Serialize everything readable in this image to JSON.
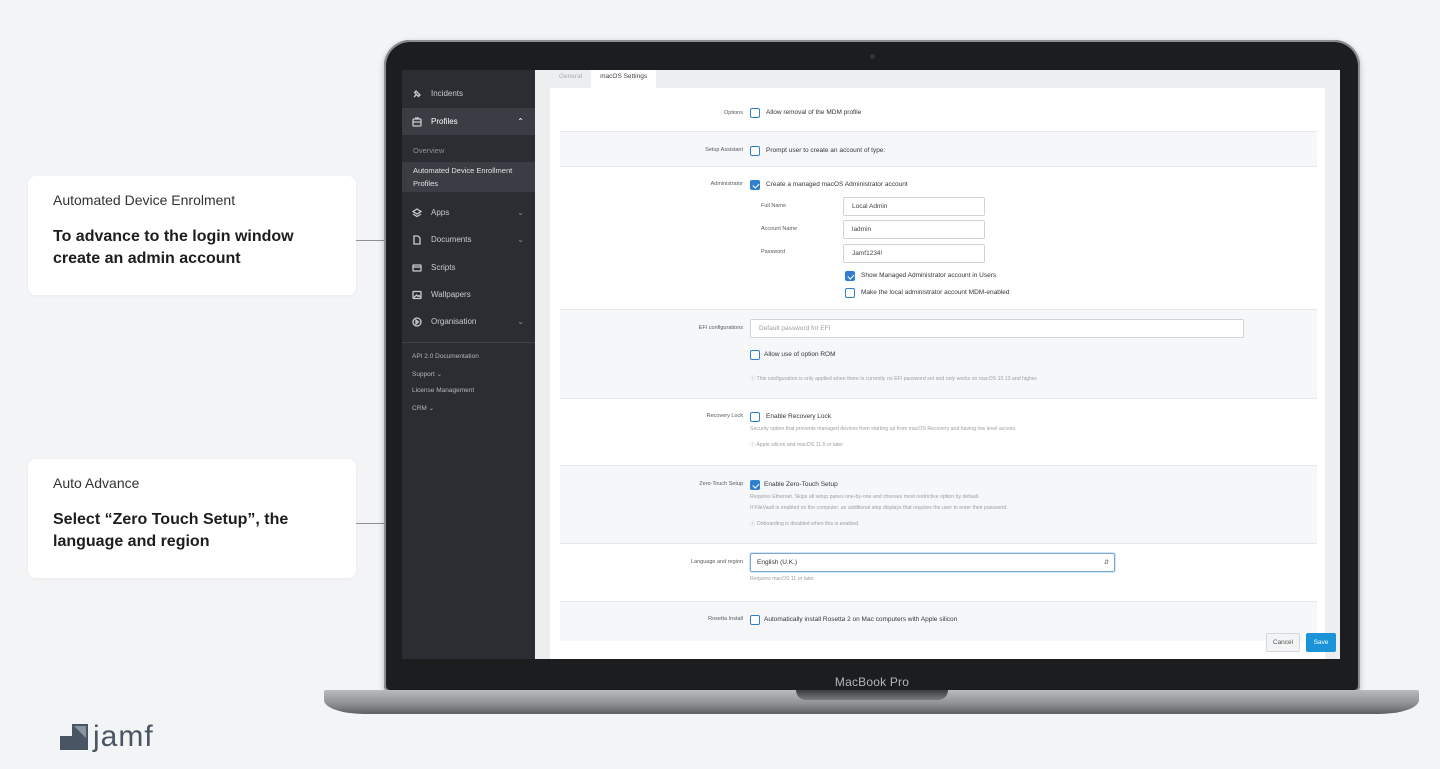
{
  "callouts": [
    {
      "title": "Automated Device Enrolment",
      "body": "To advance to the login window create an admin account"
    },
    {
      "title": "Auto Advance",
      "body": "Select “Zero Touch Setup”, the language and region"
    }
  ],
  "brand": {
    "logo_text": "jamf",
    "accent_color": "#1a93d8"
  },
  "device": {
    "model_label": "MacBook Pro"
  },
  "sidebar": {
    "items": [
      {
        "label": "Incidents",
        "icon": "pin-icon"
      },
      {
        "label": "Profiles",
        "icon": "profiles-icon",
        "expanded": true
      },
      {
        "label": "Apps",
        "icon": "layers-icon"
      },
      {
        "label": "Documents",
        "icon": "document-icon"
      },
      {
        "label": "Scripts",
        "icon": "script-icon"
      },
      {
        "label": "Wallpapers",
        "icon": "wallpaper-icon"
      },
      {
        "label": "Organisation",
        "icon": "organisation-icon"
      }
    ],
    "profiles_sub": {
      "overview": "Overview",
      "ade_profiles": "Automated Device Enrollment Profiles"
    },
    "links": [
      "API 2.0 Documentation",
      "Support ⌄",
      "License Management",
      "CRM ⌄"
    ]
  },
  "tabs": [
    {
      "label": "General",
      "active": false
    },
    {
      "label": "macOS Settings",
      "active": true
    }
  ],
  "settings": {
    "options": {
      "label": "Options",
      "checkbox_label": "Allow removal of the MDM profile",
      "checked": false
    },
    "setup_assistant": {
      "label": "Setup Assistant",
      "checkbox_label": "Prompt user to create an account of type:",
      "checked": false
    },
    "administrator": {
      "label": "Administrator",
      "checkbox_label": "Create a managed macOS Administrator account",
      "checked": true,
      "full_name_label": "Full Name",
      "full_name_value": "Local Admin",
      "account_name_label": "Account Name",
      "account_name_value": "ladmin",
      "password_label": "Password",
      "password_value": "Jamf1234!",
      "show_in_users_label": "Show Managed Administrator account in Users",
      "show_in_users_checked": true,
      "mdm_enabled_label": "Make the local administrator account MDM-enabled",
      "mdm_enabled_checked": false
    },
    "efi": {
      "label": "EFI configurations",
      "placeholder": "Default password for EFI",
      "option_rom_label": "Allow use of option ROM",
      "option_rom_checked": false,
      "note": "ⓘ This configuration is only applied when there is currently no EFI password set and only works on macOS 10.13 and higher."
    },
    "recovery_lock": {
      "label": "Recovery Lock",
      "checkbox_label": "Enable Recovery Lock",
      "checked": false,
      "description": "Security option that prevents managed devices from starting up from macOS Recovery and having low level access.",
      "note": "ⓘ Apple silicon and macOS 11.5 or later"
    },
    "zero_touch": {
      "label": "Zero-Touch Setup",
      "checkbox_label": "Enable Zero-Touch Setup",
      "checked": true,
      "desc1": "Requires Ethernet. Skips all setup panes one-by-one and chooses most restrictive option by default.",
      "desc2": "If FileVault is enabled on the computer, an additional step displays that requires the user to enter their password.",
      "note": "ⓘ Onboarding is disabled when this is enabled"
    },
    "language": {
      "label": "Language and region",
      "selected": "English (U.K.)",
      "note": "Requires macOS 11 or later"
    },
    "rosetta": {
      "label": "Rosetta Install",
      "checkbox_label": "Automatically install Rosetta 2 on Mac computers with Apple silicon",
      "checked": false
    }
  },
  "actions": {
    "cancel": "Cancel",
    "save": "Save"
  }
}
